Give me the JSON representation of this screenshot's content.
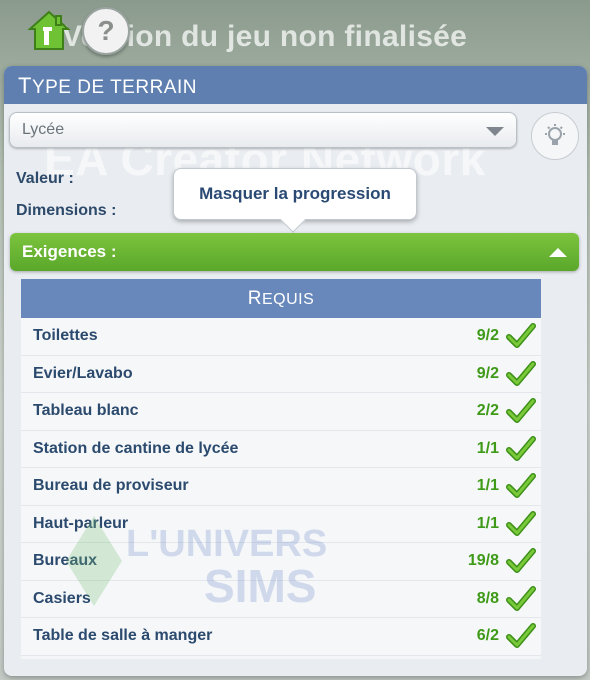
{
  "topbar": {
    "home_icon": "home-icon",
    "help_label": "?",
    "banner": "Version du jeu non finalisée"
  },
  "panel": {
    "title_first": "T",
    "title_rest": "YPE DE TERRAIN",
    "lot_type": "Lycée",
    "watermark": "EA Creator Network",
    "value_label": "Valeur :",
    "dimensions_label": "Dimensions :",
    "tooltip": "Masquer la progression",
    "requirements_label": "Exigences :"
  },
  "requirements": {
    "header_first": "R",
    "header_rest": "EQUIS",
    "items": [
      {
        "name": "Toilettes",
        "count": "9/2"
      },
      {
        "name": "Evier/Lavabo",
        "count": "9/2"
      },
      {
        "name": "Tableau blanc",
        "count": "2/2"
      },
      {
        "name": "Station de cantine de lycée",
        "count": "1/1"
      },
      {
        "name": "Bureau de proviseur",
        "count": "1/1"
      },
      {
        "name": "Haut-parleur",
        "count": "1/1"
      },
      {
        "name": "Bureaux",
        "count": "19/8"
      },
      {
        "name": "Casiers",
        "count": "8/8"
      },
      {
        "name": "Table de salle à manger",
        "count": "6/2"
      }
    ]
  },
  "watermark_logo": {
    "line1": "L'UNIVERS",
    "line2": "SIMS"
  },
  "colors": {
    "header_blue": "#5e7fb0",
    "green_bar": "#6bb535",
    "count_green": "#3f9a18",
    "text_blue": "#2b4a6e"
  }
}
